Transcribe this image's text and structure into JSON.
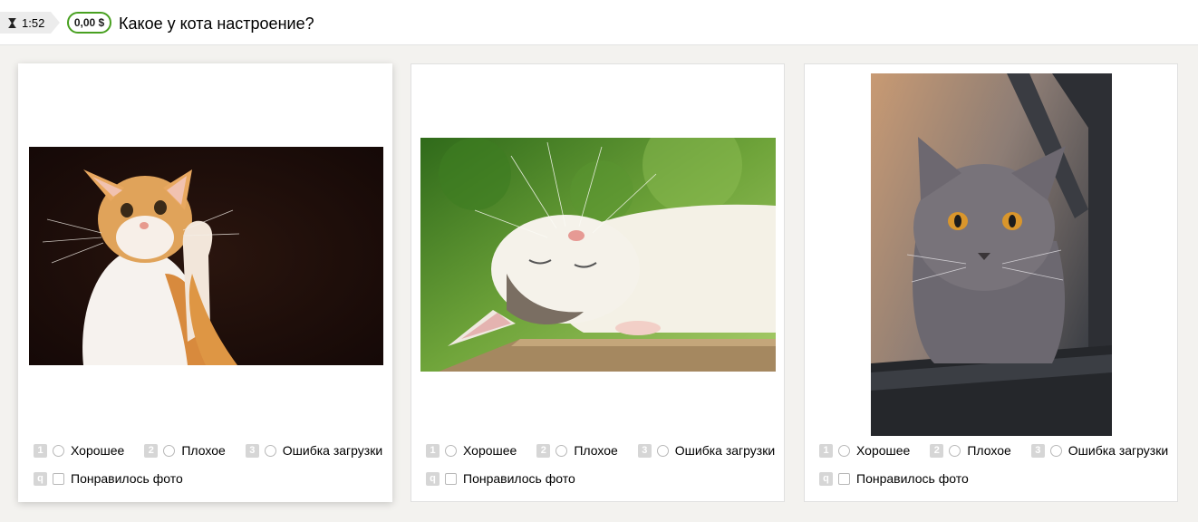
{
  "header": {
    "timer": "1:52",
    "reward": "0,00 $",
    "question": "Какое у кота настроение?"
  },
  "options": [
    {
      "key": "1",
      "label": "Хорошее"
    },
    {
      "key": "2",
      "label": "Плохое"
    },
    {
      "key": "3",
      "label": "Ошибка загрузки"
    }
  ],
  "like": {
    "key": "q",
    "label": "Понравилось фото"
  },
  "cards": [
    {
      "photo_icon": "ginger-cat-photo",
      "active": true
    },
    {
      "photo_icon": "sleeping-white-cat-photo",
      "active": false
    },
    {
      "photo_icon": "grey-cat-photo",
      "active": false
    }
  ],
  "colors": {
    "accent_green": "#48a020",
    "background": "#f3f2ef",
    "key_badge": "#d6d6d6"
  }
}
